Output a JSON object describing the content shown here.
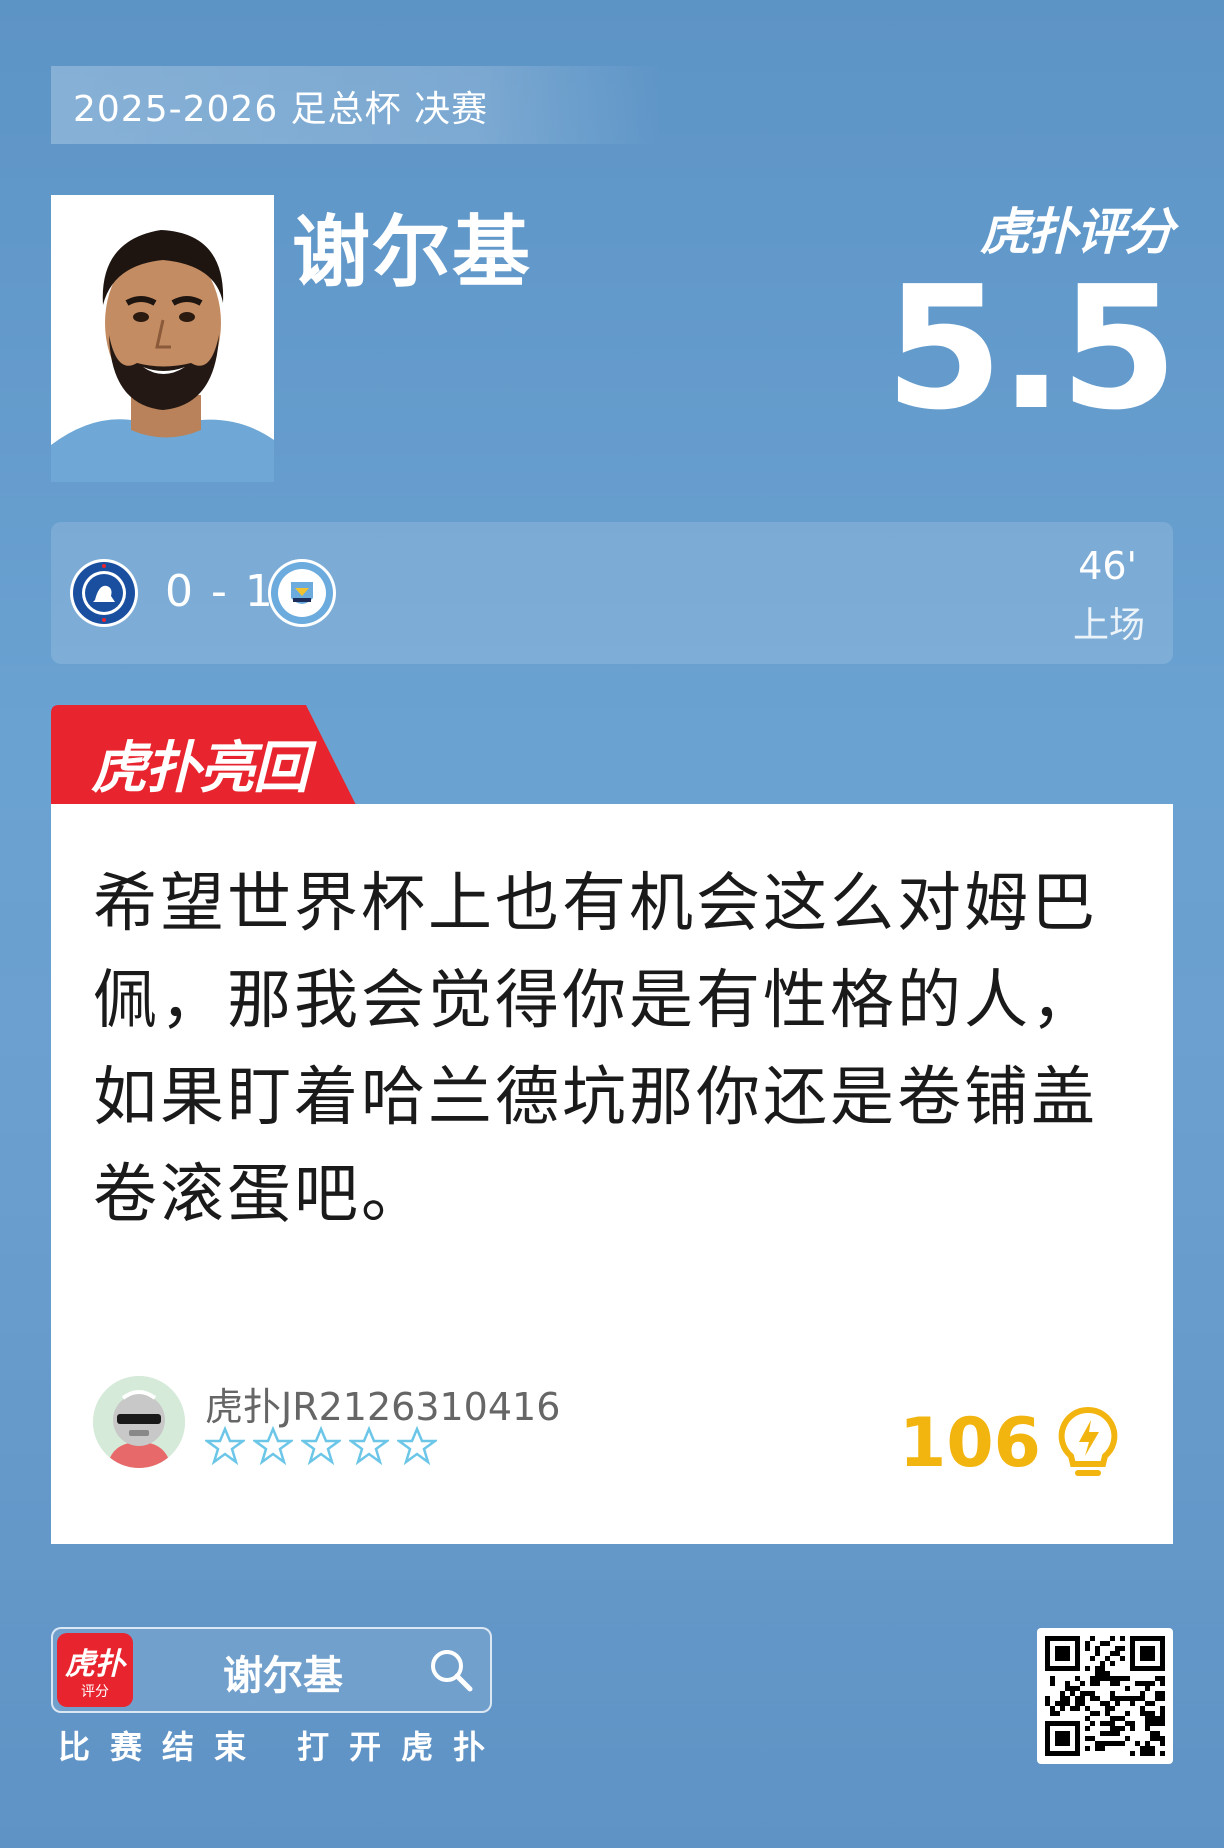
{
  "header": {
    "season_title": "2025-2026 足总杯 决赛"
  },
  "player": {
    "name": "谢尔基"
  },
  "rating": {
    "brand": "虎扑评分",
    "value": "5.5"
  },
  "match": {
    "score": "0 - 1",
    "minute": "46'",
    "status": "上场",
    "home_crest": "chelsea-crest-icon",
    "away_crest": "manchester-city-crest-icon"
  },
  "reply_tag": {
    "label": "虎扑亮回复"
  },
  "comment": {
    "lines": [
      "希望世界杯上也有机会这么对姆巴",
      "佩，那我会觉得你是有性格的人，",
      "如果盯着哈兰德坑那你还是卷铺盖",
      "卷滚蛋吧。"
    ],
    "username": "虎扑JR2126310416",
    "star_count": 5,
    "likes": "106"
  },
  "footer": {
    "app_icon_label": "虎扑",
    "app_icon_sublabel": "评分",
    "search_query": "谢尔基",
    "tagline": "比赛结束 打开虎扑"
  },
  "colors": {
    "background": "#6aa2d2",
    "accent_red": "#e8252f",
    "likes_gold": "#f2b40e",
    "star_blue": "#6cc6e8"
  }
}
